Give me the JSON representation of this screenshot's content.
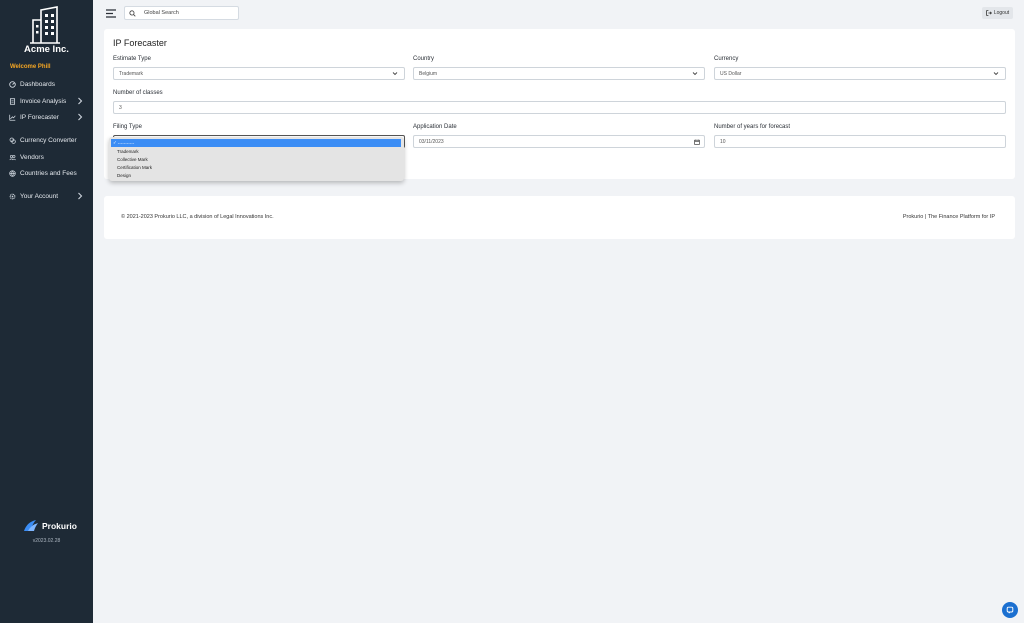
{
  "sidebar": {
    "company": "Acme Inc.",
    "welcome": "Welcome Phill",
    "items": [
      {
        "label": "Dashboards",
        "icon": "dashboard-icon"
      },
      {
        "label": "Invoice Analysis",
        "icon": "invoice-icon"
      },
      {
        "label": "IP Forecaster",
        "icon": "chart-line-icon"
      },
      {
        "label": "Currency Converter",
        "icon": "currency-icon"
      },
      {
        "label": "Vendors",
        "icon": "users-icon"
      },
      {
        "label": "Countries and Fees",
        "icon": "globe-icon"
      },
      {
        "label": "Your Account",
        "icon": "gear-icon"
      }
    ],
    "brand": "Prokurio",
    "version": "v2023.02.28"
  },
  "topbar": {
    "search_placeholder": "Global Search",
    "logout_label": "Logout"
  },
  "form": {
    "title": "IP Forecaster",
    "estimate_type_label": "Estimate Type",
    "estimate_type_value": "Trademark",
    "country_label": "Country",
    "country_value": "Belgium",
    "currency_label": "Currency",
    "currency_value": "US Dollar",
    "classes_label": "Number of classes",
    "classes_value": "3",
    "filing_type_label": "Filing Type",
    "application_date_label": "Application Date",
    "application_date_value": "03/11/2023",
    "years_label": "Number of years for forecast",
    "years_value": "10"
  },
  "filing_dropdown": {
    "selected": "-----------",
    "options": [
      "Trademark",
      "Collective Mark",
      "Certification Mark",
      "Design"
    ]
  },
  "footer": {
    "left": "© 2021-2023 Prokurio LLC, a division of Legal Innovations Inc.",
    "right": "Prokurio | The Finance Platform for IP"
  },
  "colors": {
    "sidebar_bg": "#1e2a36",
    "welcome": "#f5a623",
    "accent": "#3b8df5",
    "chat": "#1b6fd0"
  }
}
